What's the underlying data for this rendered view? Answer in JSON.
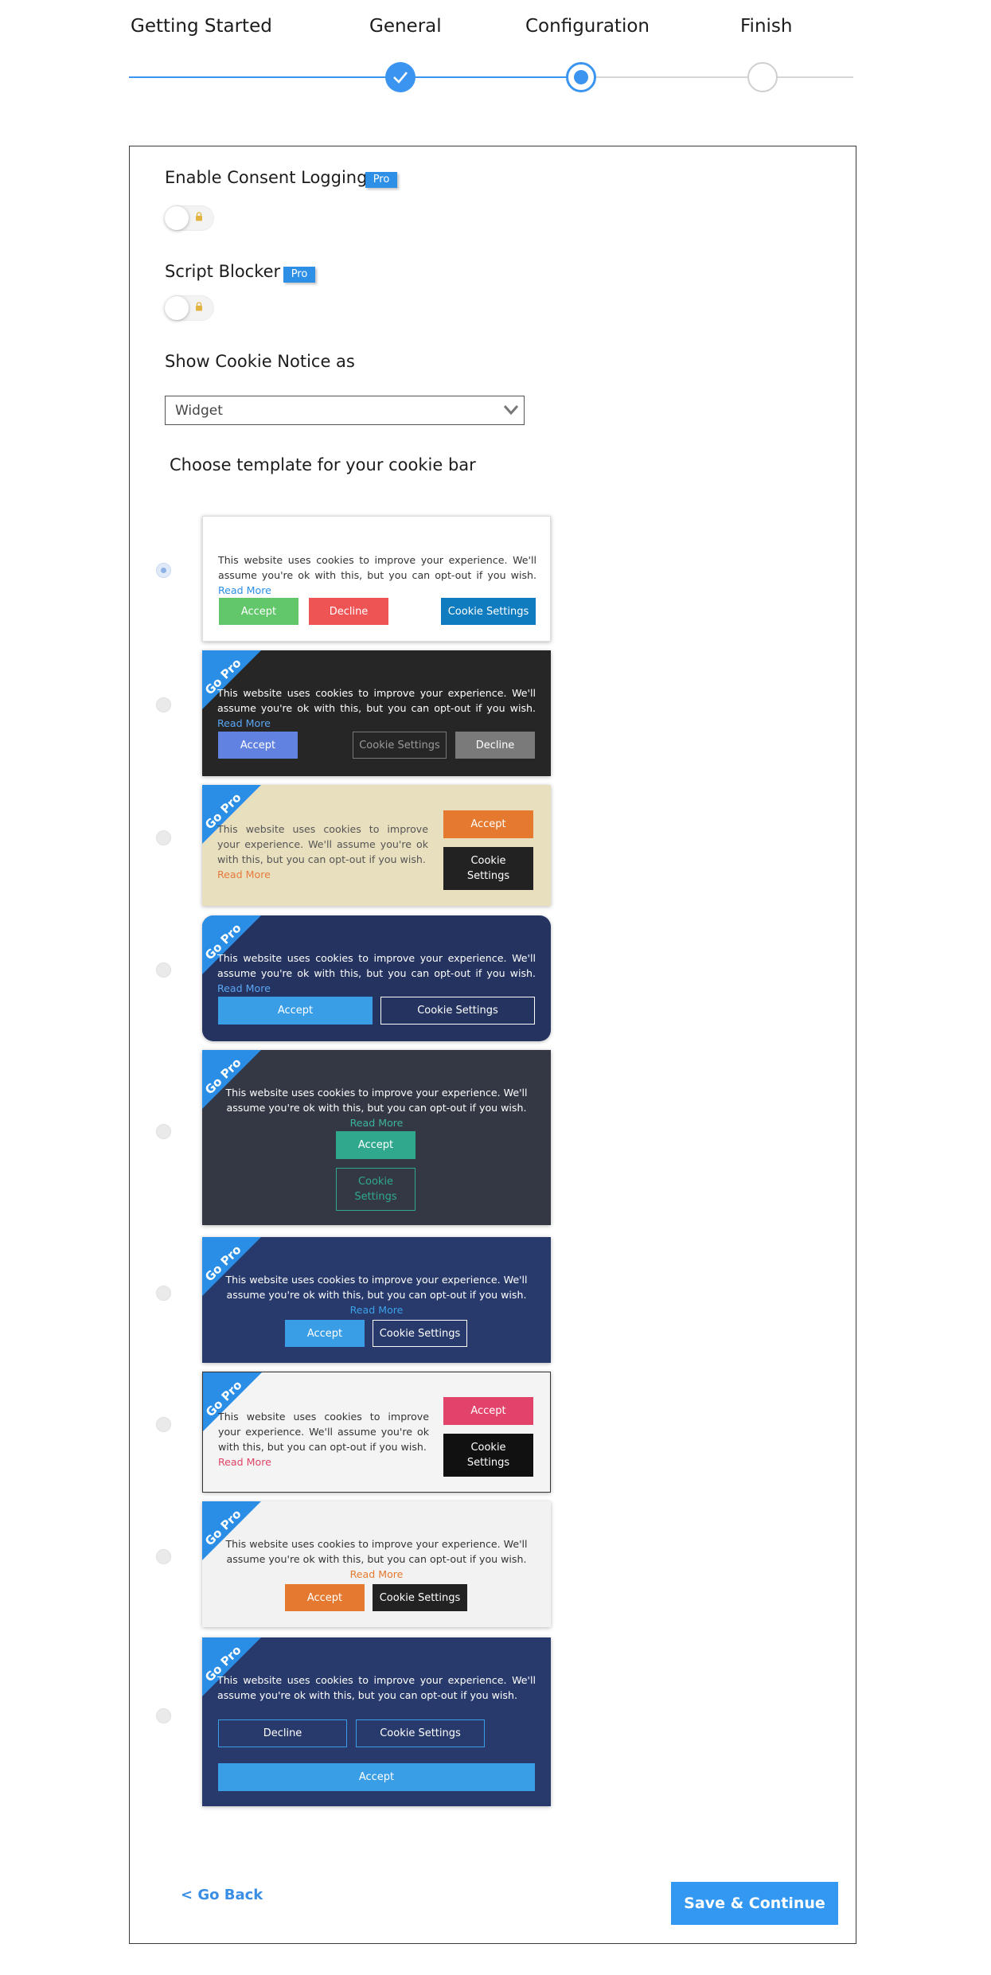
{
  "steps": [
    {
      "label": "Getting Started",
      "state": "done"
    },
    {
      "label": "General",
      "state": "done"
    },
    {
      "label": "Configuration",
      "state": "current"
    },
    {
      "label": "Finish",
      "state": "todo"
    }
  ],
  "colors": {
    "accent": "#3b95f0",
    "pro_badge": "#2e8fe6",
    "save_button": "#3398f2"
  },
  "consent_logging": {
    "title": "Enable Consent Logging",
    "badge": "Pro",
    "enabled": false,
    "icon": "lock-icon"
  },
  "script_blocker": {
    "title": "Script Blocker",
    "badge": "Pro",
    "enabled": false,
    "icon": "lock-icon"
  },
  "cookie_notice": {
    "title": "Show Cookie Notice as",
    "selected": "Widget",
    "icon": "chevron-down-icon"
  },
  "templates_title": "Choose template for your cookie bar",
  "ribbon_label": "Go Pro",
  "templates": [
    {
      "selected": true,
      "message": "This website uses cookies to improve your experience. We'll assume you're ok with this, but you can opt-out if you wish.",
      "read_more": "Read More",
      "buttons": [
        "Accept",
        "Decline",
        "Cookie Settings"
      ]
    },
    {
      "selected": false,
      "message": "This website uses cookies to improve your experience. We'll assume you're ok with this, but you can opt-out if you wish.",
      "read_more": "Read More",
      "buttons": [
        "Accept",
        "Cookie Settings",
        "Decline"
      ]
    },
    {
      "selected": false,
      "message": "This website uses cookies to improve your experience. We'll assume you're ok with this, but you can opt-out if you wish.",
      "read_more": "Read More",
      "buttons": [
        "Accept",
        "Cookie Settings"
      ]
    },
    {
      "selected": false,
      "message": "This website uses cookies to improve your experience. We'll assume you're ok with this, but you can opt-out if you wish.",
      "read_more": "Read More",
      "buttons": [
        "Accept",
        "Cookie Settings"
      ]
    },
    {
      "selected": false,
      "message": "This website uses cookies to improve your experience. We'll assume you're ok with this, but you can opt-out if you wish.",
      "read_more": "Read More",
      "buttons": [
        "Accept",
        "Cookie Settings"
      ]
    },
    {
      "selected": false,
      "message": "This website uses cookies to improve your experience. We'll assume you're ok with this, but you can opt-out if you wish.",
      "read_more": "Read More",
      "buttons": [
        "Accept",
        "Cookie Settings"
      ]
    },
    {
      "selected": false,
      "message": "This website uses cookies to improve your experience. We'll assume you're ok with this, but you can opt-out if you wish.",
      "read_more": "Read More",
      "buttons": [
        "Accept",
        "Cookie Settings"
      ]
    },
    {
      "selected": false,
      "message": "This website uses cookies to improve your experience. We'll assume you're ok with this, but you can opt-out if you wish.",
      "read_more": "Read More",
      "buttons": [
        "Accept",
        "Cookie Settings"
      ]
    },
    {
      "selected": false,
      "message": "This website uses cookies to improve your experience. We'll assume you're ok with this, but you can opt-out if you wish.",
      "read_more": "",
      "buttons": [
        "Decline",
        "Cookie Settings",
        "Accept"
      ]
    }
  ],
  "footer": {
    "back_label": "< Go Back",
    "save_label": "Save & Continue"
  }
}
